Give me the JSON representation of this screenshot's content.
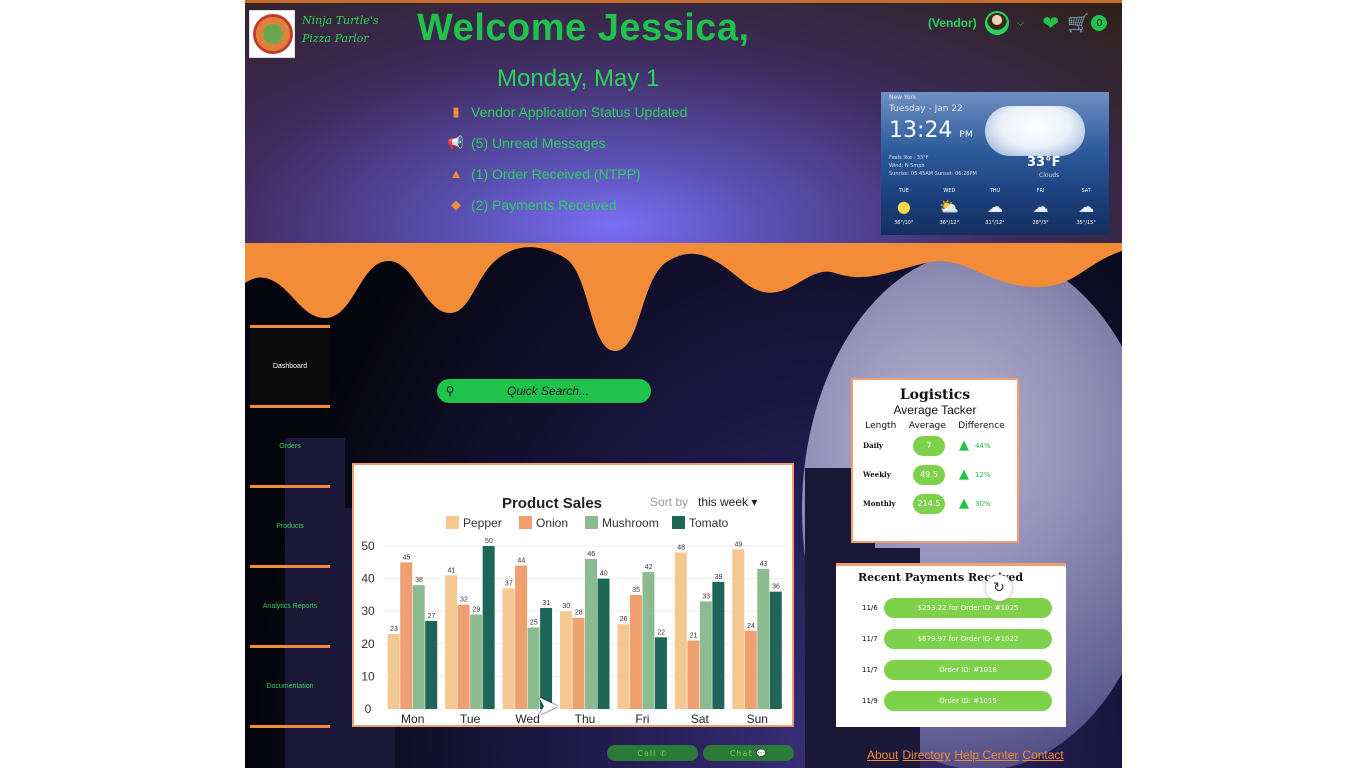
{
  "brand": {
    "name_line1": "Ninja Turtle's",
    "name_line2": "Pizza Parlor"
  },
  "header": {
    "welcome": "Welcome Jessica,",
    "date": "Monday, May 1",
    "role": "(Vendor)",
    "cart_count": "0",
    "icons": [
      "user-avatar",
      "heart-icon",
      "cart-icon",
      "chevron-down-icon"
    ]
  },
  "notifications": [
    {
      "icon": "file-icon",
      "text": "Vendor Application Status Updated"
    },
    {
      "icon": "megaphone-icon",
      "text": "(5) Unread Messages"
    },
    {
      "icon": "bag-icon",
      "text": "(1) Order Received (NTPP)"
    },
    {
      "icon": "tag-icon",
      "text": "(2) Payments Received"
    }
  ],
  "weather": {
    "location": "New York",
    "day": "Tuesday - Jan 22",
    "time": "13:24",
    "ampm": "PM",
    "temp": "33°F",
    "condition": "Clouds",
    "feels": "Feels like : 33°F",
    "wind": "Wind: N 5mph",
    "sun": "Sunrise: 05:45AM      Sunset: 06:28PM",
    "forecast": [
      {
        "day": "TUE",
        "range": "36°/10°",
        "icon": "sun"
      },
      {
        "day": "WED",
        "range": "36°/12°",
        "icon": "partly-cloudy"
      },
      {
        "day": "THU",
        "range": "31°/12°",
        "icon": "snow"
      },
      {
        "day": "FRI",
        "range": "28°/3°",
        "icon": "storm"
      },
      {
        "day": "SAT",
        "range": "35°/15°",
        "icon": "snow"
      }
    ]
  },
  "sidebar": {
    "items": [
      {
        "label": "Dashboard",
        "active": true
      },
      {
        "label": "Orders"
      },
      {
        "label": "Products"
      },
      {
        "label": "Analytics Reports"
      },
      {
        "label": "Documentation"
      }
    ]
  },
  "search": {
    "placeholder": "Quick Search..."
  },
  "chart_data": {
    "type": "bar",
    "title": "Product Sales",
    "sort_label": "Sort by",
    "sort_value": "this week",
    "categories": [
      "Mon",
      "Tue",
      "Wed",
      "Thu",
      "Fri",
      "Sat",
      "Sun"
    ],
    "series": [
      {
        "name": "Pepper",
        "color": "#f5c892",
        "values": [
          23,
          41,
          37,
          30,
          26,
          48,
          49
        ]
      },
      {
        "name": "Onion",
        "color": "#f0a070",
        "values": [
          45,
          32,
          44,
          28,
          35,
          21,
          24
        ]
      },
      {
        "name": "Mushroom",
        "color": "#8dbb90",
        "values": [
          38,
          29,
          25,
          46,
          42,
          33,
          43
        ]
      },
      {
        "name": "Tomato",
        "color": "#1e6657",
        "values": [
          27,
          50,
          31,
          40,
          22,
          39,
          36
        ]
      }
    ],
    "ylim": [
      0,
      50
    ],
    "yticks": [
      0,
      10,
      20,
      30,
      40,
      50
    ],
    "legend": "top"
  },
  "logistics": {
    "title": "Logistics",
    "subtitle": "Average Tacker",
    "columns": [
      "Length",
      "Average",
      "Difference"
    ],
    "rows": [
      {
        "label": "Daily",
        "average": "7",
        "diff": "44%"
      },
      {
        "label": "Weekly",
        "average": "49.5",
        "diff": "12%"
      },
      {
        "label": "Monthly",
        "average": "214.5",
        "diff": "30%"
      }
    ]
  },
  "payments": {
    "title": "Recent Payments Received",
    "rows": [
      {
        "date": "11/6",
        "text": "$253.22 for Order ID: #1025"
      },
      {
        "date": "11/7",
        "text": "$679.97 for Order ID: #1022"
      },
      {
        "date": "11/7",
        "text": "Order ID: #1018"
      },
      {
        "date": "11/9",
        "text": "Order ID: #1015"
      }
    ]
  },
  "actions": {
    "call": "Call ✆",
    "chat": "Chat 💬"
  },
  "footer": {
    "links": [
      "About",
      "Directory",
      "Help Center",
      "Contact"
    ]
  },
  "colors": {
    "accent": "#1fc24a",
    "orange": "#f28c38",
    "pill": "#7ed14a"
  }
}
